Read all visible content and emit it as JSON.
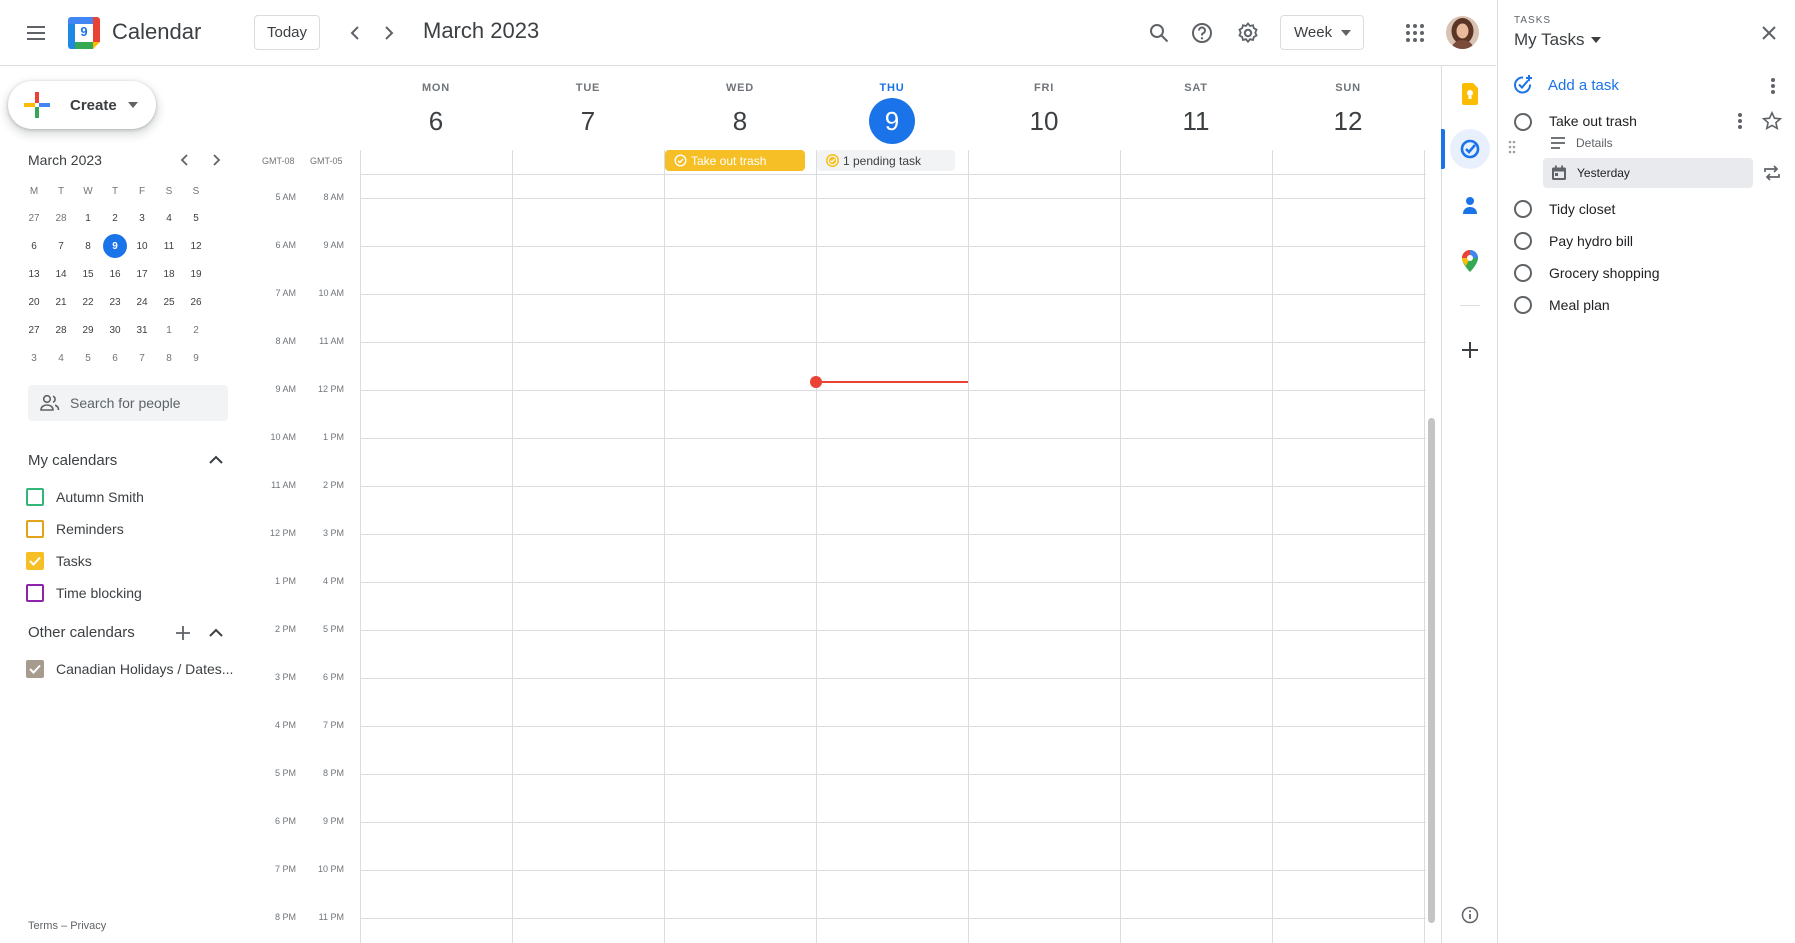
{
  "header": {
    "app_name": "Calendar",
    "logo_day": "9",
    "today_label": "Today",
    "period_title": "March 2023",
    "view_label": "Week",
    "icons": [
      "menu-icon",
      "prev-icon",
      "next-icon",
      "search-icon",
      "help-icon",
      "settings-icon",
      "apps-icon",
      "avatar"
    ]
  },
  "sidebar": {
    "create_label": "Create",
    "mini_calendar": {
      "title": "March 2023",
      "weekdays": [
        "M",
        "T",
        "W",
        "T",
        "F",
        "S",
        "S"
      ],
      "weeks": [
        [
          "27",
          "28",
          "1",
          "2",
          "3",
          "4",
          "5"
        ],
        [
          "6",
          "7",
          "8",
          "9",
          "10",
          "11",
          "12"
        ],
        [
          "13",
          "14",
          "15",
          "16",
          "17",
          "18",
          "19"
        ],
        [
          "20",
          "21",
          "22",
          "23",
          "24",
          "25",
          "26"
        ],
        [
          "27",
          "28",
          "29",
          "30",
          "31",
          "1",
          "2"
        ],
        [
          "3",
          "4",
          "5",
          "6",
          "7",
          "8",
          "9"
        ]
      ],
      "today": "9"
    },
    "search_people_placeholder": "Search for people",
    "my_calendars_title": "My calendars",
    "my_calendars": [
      {
        "label": "Autumn Smith",
        "color": "#33b679",
        "checked": false
      },
      {
        "label": "Reminders",
        "color": "#e4a11b",
        "checked": false
      },
      {
        "label": "Tasks",
        "color": "#f6bf26",
        "checked": true
      },
      {
        "label": "Time blocking",
        "color": "#8e24aa",
        "checked": false
      }
    ],
    "other_calendars_title": "Other calendars",
    "other_calendars": [
      {
        "label": "Canadian Holidays / Dates...",
        "color": "#a79b8e",
        "checked": true
      }
    ],
    "footer": {
      "terms": "Terms",
      "sep": "–",
      "privacy": "Privacy"
    }
  },
  "week": {
    "days": [
      {
        "name": "MON",
        "date": "6"
      },
      {
        "name": "TUE",
        "date": "7"
      },
      {
        "name": "WED",
        "date": "8"
      },
      {
        "name": "THU",
        "date": "9",
        "today": true
      },
      {
        "name": "FRI",
        "date": "10"
      },
      {
        "name": "SAT",
        "date": "11"
      },
      {
        "name": "SUN",
        "date": "12"
      }
    ],
    "timezones": [
      "GMT-08",
      "GMT-05"
    ],
    "times_primary": [
      "5 AM",
      "6 AM",
      "7 AM",
      "8 AM",
      "9 AM",
      "10 AM",
      "11 AM",
      "12 PM",
      "1 PM",
      "2 PM",
      "3 PM",
      "4 PM",
      "5 PM",
      "6 PM",
      "7 PM",
      "8 PM"
    ],
    "times_secondary": [
      "8 AM",
      "9 AM",
      "10 AM",
      "11 AM",
      "12 PM",
      "1 PM",
      "2 PM",
      "3 PM",
      "4 PM",
      "5 PM",
      "6 PM",
      "7 PM",
      "8 PM",
      "9 PM",
      "10 PM",
      "11 PM"
    ],
    "all_day": [
      {
        "label": "Take out trash",
        "day": "WED",
        "color": "#f6bf26"
      },
      {
        "label": "1 pending task",
        "day": "THU",
        "color": "#f1f3f4"
      }
    ],
    "current_time_color": "#ea4335"
  },
  "tasks_panel": {
    "section": "TASKS",
    "list_name": "My Tasks",
    "add_task": "Add a task",
    "selected": {
      "title": "Take out trash",
      "details": "Details",
      "due": "Yesterday"
    },
    "tasks": [
      "Tidy closet",
      "Pay hydro bill",
      "Grocery shopping",
      "Meal plan"
    ]
  },
  "colors": {
    "accent": "#1a73e8",
    "grid": "#dadce0"
  }
}
